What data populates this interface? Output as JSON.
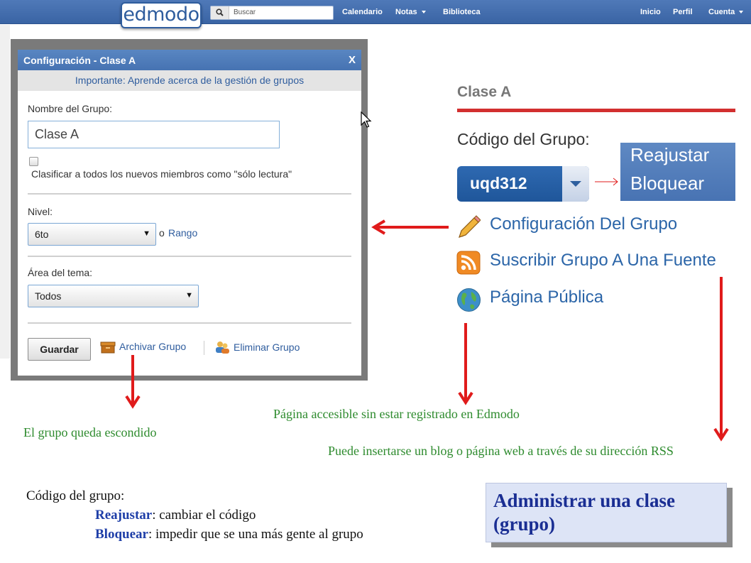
{
  "topbar": {
    "logo": "edmodo",
    "search_placeholder": "Buscar",
    "nav_left": [
      "Calendario",
      "Notas",
      "Biblioteca"
    ],
    "nav_right": [
      "Inicio",
      "Perfil",
      "Cuenta"
    ]
  },
  "dialog": {
    "title": "Configuración - Clase A",
    "close": "X",
    "notice": "Importante: Aprende acerca de la gestión de grupos",
    "group_name_label": "Nombre del Grupo:",
    "group_name_value": "Clase A",
    "readonly_checkbox_label": "Clasificar a todos los nuevos miembros como \"sólo lectura\"",
    "level_label": "Nivel:",
    "level_value": "6to",
    "level_or": "o",
    "level_range_link": "Rango",
    "subject_label": "Área del tema:",
    "subject_value": "Todos",
    "save_button": "Guardar",
    "archive_link": "Archivar Grupo",
    "delete_link": "Eliminar Grupo"
  },
  "panel": {
    "title": "Clase A",
    "code_label": "Código del Grupo:",
    "code_value": "uqd312",
    "code_menu": [
      "Reajustar",
      "Bloquear"
    ],
    "links": {
      "settings": "Configuración Del Grupo",
      "subscribe": "Suscribir Grupo A Una Fuente",
      "public_page": "Página Pública"
    }
  },
  "annotations": {
    "hidden_group": "El grupo queda escondido",
    "public_page_note": "Página accesible sin estar registrado en Edmodo",
    "rss_note": "Puede insertarse un blog o página web a través de su dirección RSS",
    "code_heading": "Código del grupo:",
    "reset_term": "Reajustar",
    "reset_desc": ": cambiar el código",
    "lock_term": "Bloquear",
    "lock_desc": ": impedir que se una más gente al grupo",
    "slide_title": "Administrar una clase (grupo)"
  },
  "colors": {
    "topbar": "#4a74b3",
    "link": "#2f5d9e",
    "arrow_red": "#e01b1b",
    "note_green": "#2e8b2e",
    "title_blue": "#1a2e93"
  }
}
